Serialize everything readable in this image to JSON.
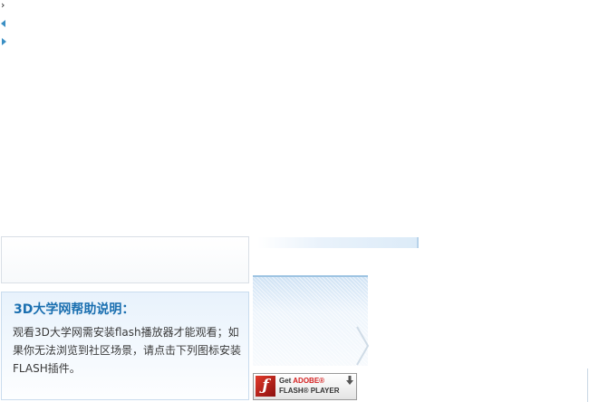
{
  "nav": {
    "top_glyph": "›"
  },
  "help": {
    "title": "3D大学网帮助说明：",
    "body": "观看3D大学网需安装flash播放器才能观看；如果你无法浏览到社区场景，请点击下列图标安装FLASH插件。"
  },
  "flash_badge": {
    "get": "Get",
    "adobe": "ADOBE®",
    "player": "FLASH® PLAYER"
  },
  "colors": {
    "accent": "#1a6fb0",
    "arrow": "#3a8fc4",
    "flash_red": "#d42020"
  },
  "icons": [
    "chevron-right-icon",
    "arrow-left-icon",
    "arrow-right-icon",
    "flash-logo-icon",
    "download-icon"
  ]
}
